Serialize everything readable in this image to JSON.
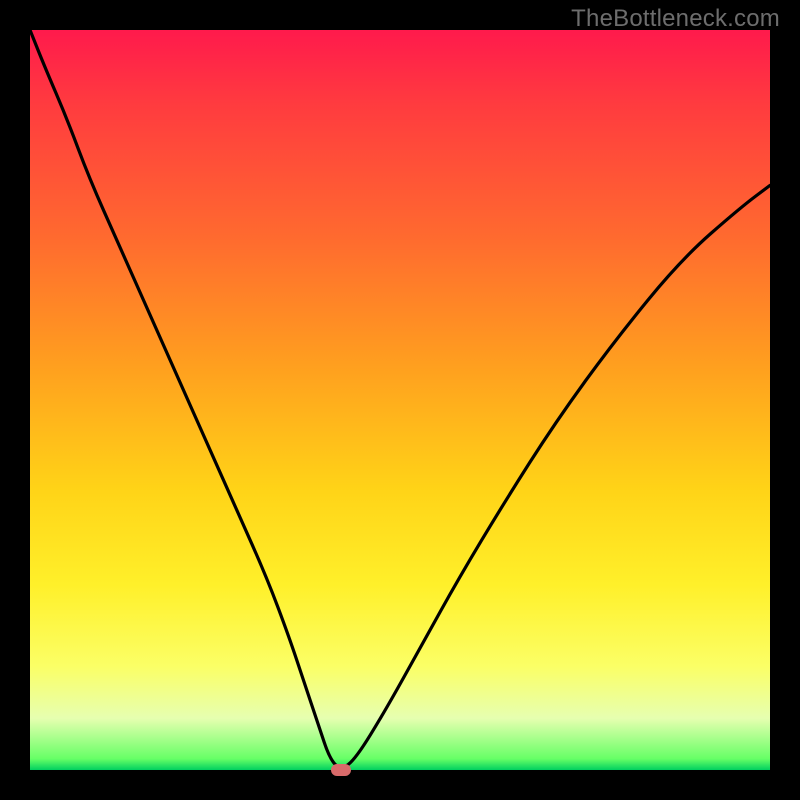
{
  "watermark": "TheBottleneck.com",
  "colors": {
    "frame": "#000000",
    "curve": "#000000",
    "marker": "#d86a6a",
    "watermark": "#6d6d6d",
    "gradient_top": "#ff1a4c",
    "gradient_bottom": "#00d060"
  },
  "chart_data": {
    "type": "line",
    "title": "",
    "xlabel": "",
    "ylabel": "",
    "xlim": [
      0,
      100
    ],
    "ylim": [
      0,
      100
    ],
    "grid": false,
    "legend": "none",
    "series": [
      {
        "name": "bottleneck-curve",
        "x": [
          0,
          2,
          5,
          8,
          12,
          16,
          20,
          24,
          28,
          32,
          35,
          37,
          39,
          40.5,
          42,
          44,
          48,
          53,
          58,
          64,
          71,
          79,
          88,
          96,
          100
        ],
        "y": [
          100,
          95,
          88,
          80,
          71,
          62,
          53,
          44,
          35,
          26,
          18,
          12,
          6,
          1.5,
          0,
          1.5,
          8,
          17,
          26,
          36,
          47,
          58,
          69,
          76,
          79
        ]
      }
    ],
    "annotations": [
      {
        "name": "optimum-marker",
        "x": 42,
        "y": 0,
        "shape": "pill",
        "color": "#d86a6a"
      }
    ]
  }
}
